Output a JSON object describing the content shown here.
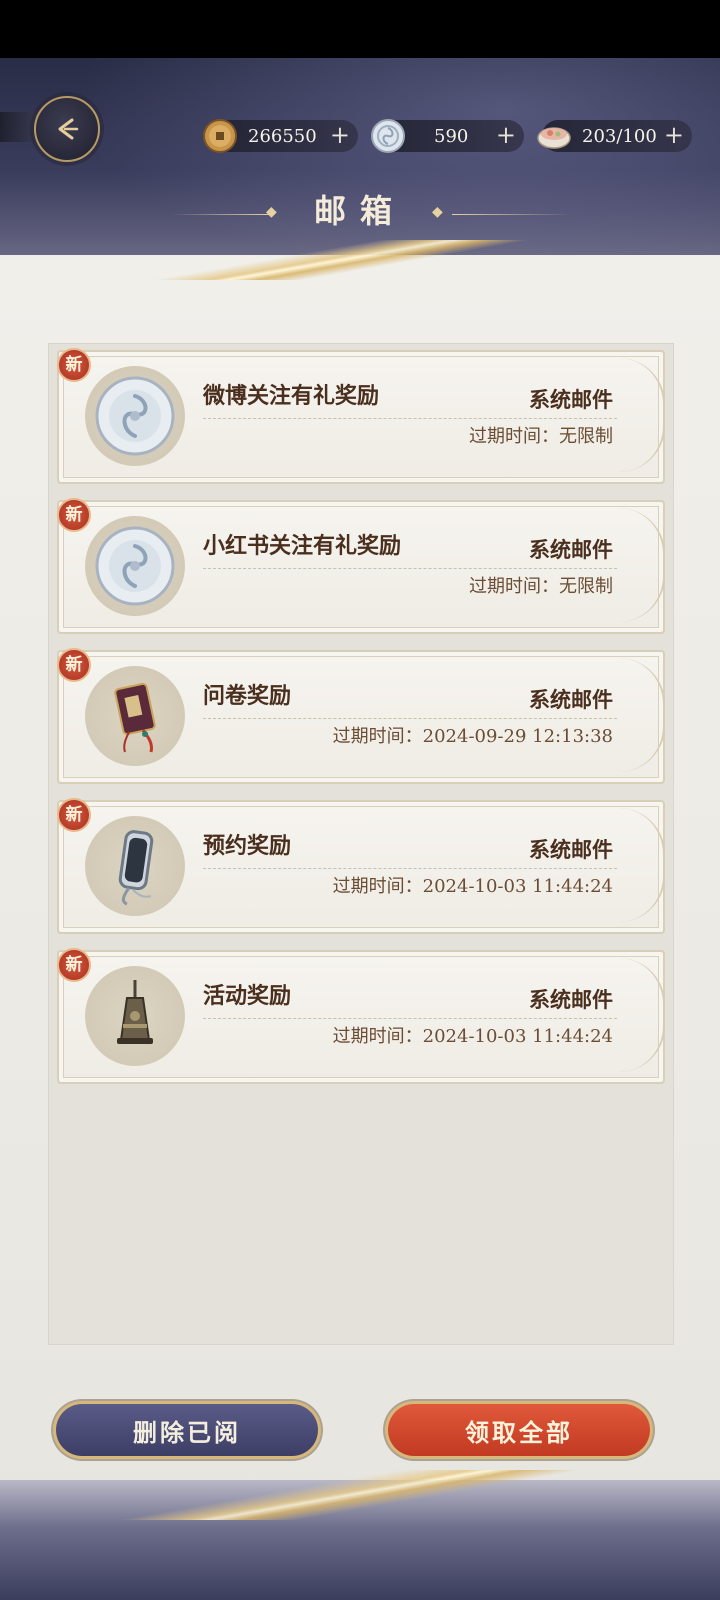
{
  "header": {
    "title": "邮箱",
    "back_icon": "back-arrow-icon",
    "currencies": [
      {
        "name": "coin",
        "icon": "copper-coin-icon",
        "value": "266550",
        "plus": "+"
      },
      {
        "name": "silver",
        "icon": "silver-jade-icon",
        "value": "590",
        "plus": "+"
      },
      {
        "name": "food",
        "icon": "food-bowl-icon",
        "value": "203/100",
        "plus": "+"
      }
    ]
  },
  "mails": [
    {
      "badge": "新",
      "subject": "微博关注有礼奖励",
      "sender": "系统邮件",
      "expire": "过期时间：无限制",
      "icon": "silver-jade-icon"
    },
    {
      "badge": "新",
      "subject": "小红书关注有礼奖励",
      "sender": "系统邮件",
      "expire": "过期时间：无限制",
      "icon": "silver-jade-icon"
    },
    {
      "badge": "新",
      "subject": "问卷奖励",
      "sender": "系统邮件",
      "expire": "过期时间：2024-09-29 12:13:38",
      "icon": "tassel-pendant-icon"
    },
    {
      "badge": "新",
      "subject": "预约奖励",
      "sender": "系统邮件",
      "expire": "过期时间：2024-10-03 11:44:24",
      "icon": "mirror-icon"
    },
    {
      "badge": "新",
      "subject": "活动奖励",
      "sender": "系统邮件",
      "expire": "过期时间：2024-10-03 11:44:24",
      "icon": "bell-icon"
    }
  ],
  "actions": {
    "delete_read": "删除已阅",
    "claim_all": "领取全部"
  }
}
